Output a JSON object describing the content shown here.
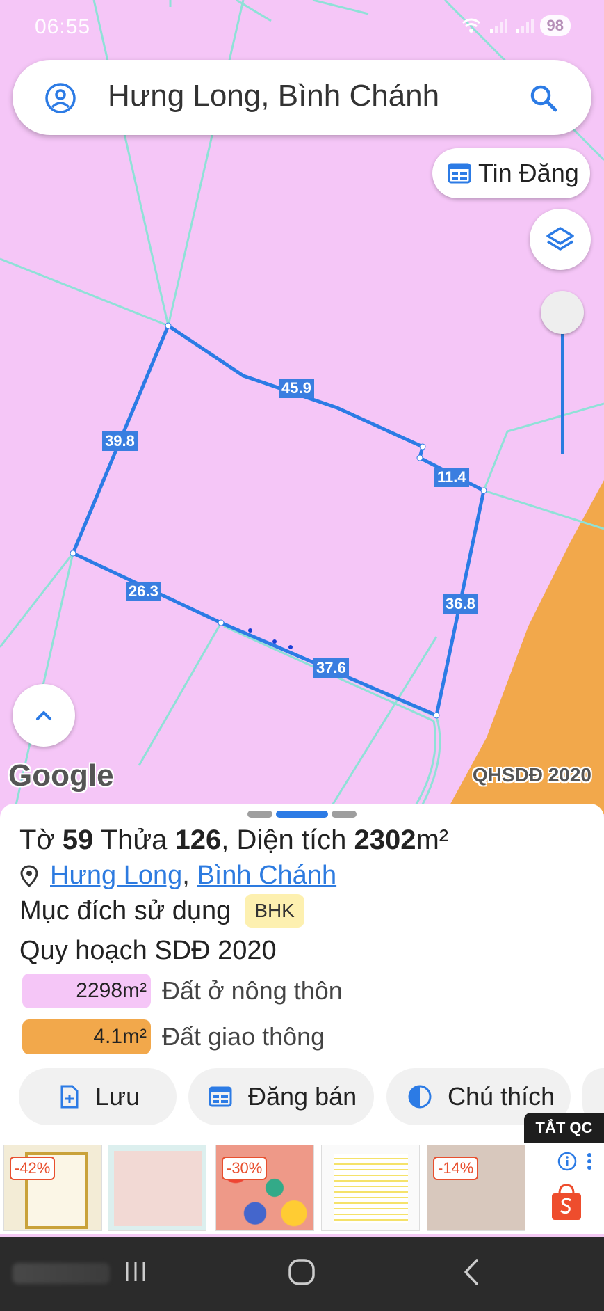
{
  "status_bar": {
    "time": "06:55",
    "battery": "98",
    "icons": [
      "wifi-icon",
      "signal-icon",
      "signal-icon-2"
    ]
  },
  "search": {
    "value": "Hưng Long, Bình Chánh",
    "icon_left": "avatar-icon",
    "icon_right": "search-icon"
  },
  "map": {
    "tin_dang_label": "Tin Đăng",
    "layers_icon": "layers-icon",
    "google_logo": "Google",
    "layer_name": "QHSDĐ 2020",
    "edge_labels": [
      "45.9",
      "39.8",
      "11.4",
      "36.8",
      "26.3",
      "37.6"
    ],
    "colors": {
      "residential": "#f5c6f7",
      "traffic": "#f2a84b",
      "parcel_boundary": "#2c7be5",
      "plot_lines": "#8fe1d7"
    }
  },
  "parcel": {
    "sheet_prefix": "Tờ",
    "sheet_no": "59",
    "plot_prefix": "Thửa",
    "plot_no": "126",
    "area_prefix": ", Diện tích",
    "area_value": "2302",
    "area_unit": "m²",
    "location_commune": "Hưng Long",
    "location_sep": ",",
    "location_district": "Bình Chánh",
    "purpose_label": "Mục đích sử dụng",
    "purpose_code": "BHK",
    "plan_title": "Quy hoạch SDĐ 2020",
    "land_uses": [
      {
        "area": "2298m²",
        "name": "Đất ở nông thôn",
        "color": "#f5c6f7"
      },
      {
        "area": "4.1m²",
        "name": "Đất giao thông",
        "color": "#f2a84b"
      }
    ]
  },
  "actions": {
    "save": "Lưu",
    "post_sale": "Đăng bán",
    "legend": "Chú thích"
  },
  "ads": {
    "label": "TẮT QC",
    "discounts": [
      "-42%",
      "-30%",
      "-14%"
    ]
  }
}
